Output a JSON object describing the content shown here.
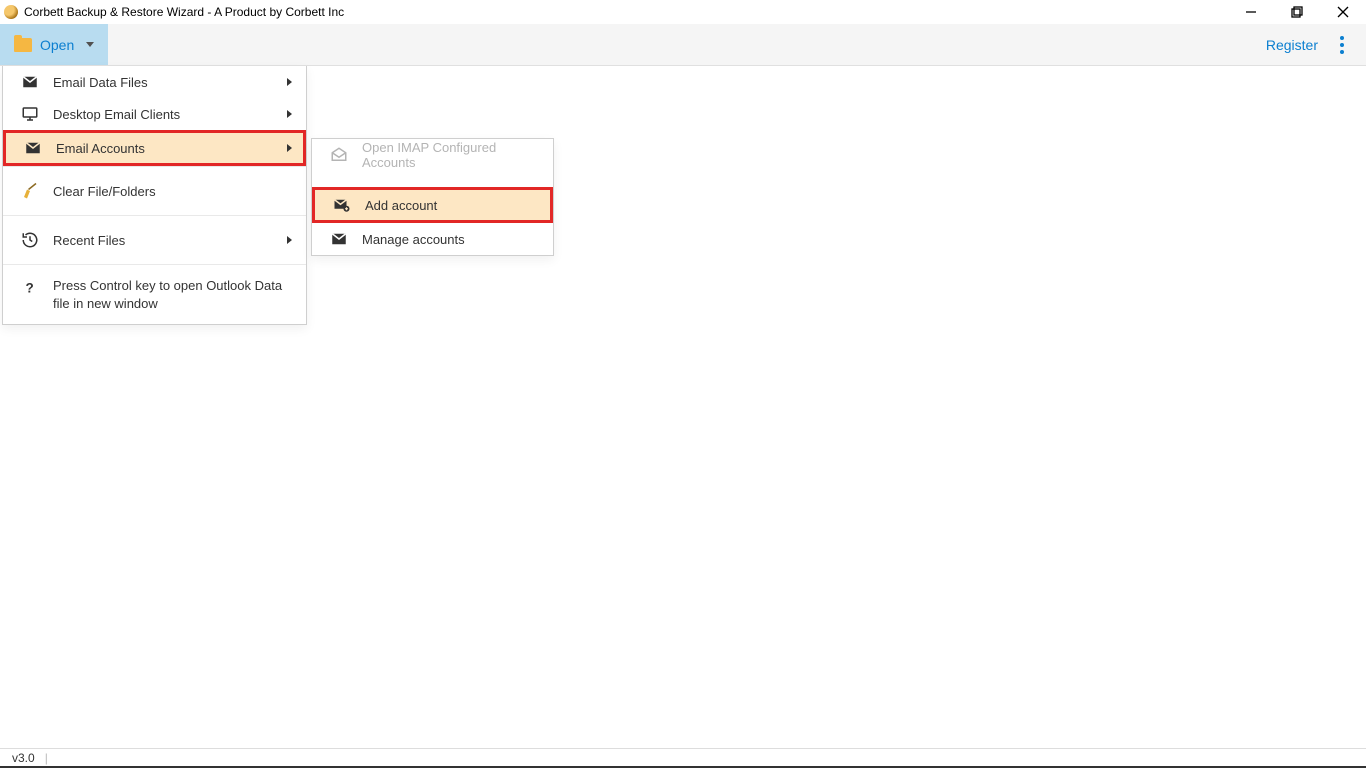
{
  "titlebar": {
    "title": "Corbett Backup & Restore Wizard - A Product by Corbett Inc"
  },
  "toolbar": {
    "open_label": "Open",
    "register_label": "Register"
  },
  "menu": {
    "items": [
      {
        "label": "Email Data Files"
      },
      {
        "label": "Desktop Email Clients"
      },
      {
        "label": "Email Accounts"
      },
      {
        "label": "Clear File/Folders"
      },
      {
        "label": "Recent Files"
      }
    ],
    "hint": "Press Control key to open Outlook Data file in new window"
  },
  "submenu": {
    "items": [
      {
        "label": "Open IMAP Configured Accounts"
      },
      {
        "label": "Add account"
      },
      {
        "label": "Manage accounts"
      }
    ]
  },
  "statusbar": {
    "version": "v3.0"
  }
}
